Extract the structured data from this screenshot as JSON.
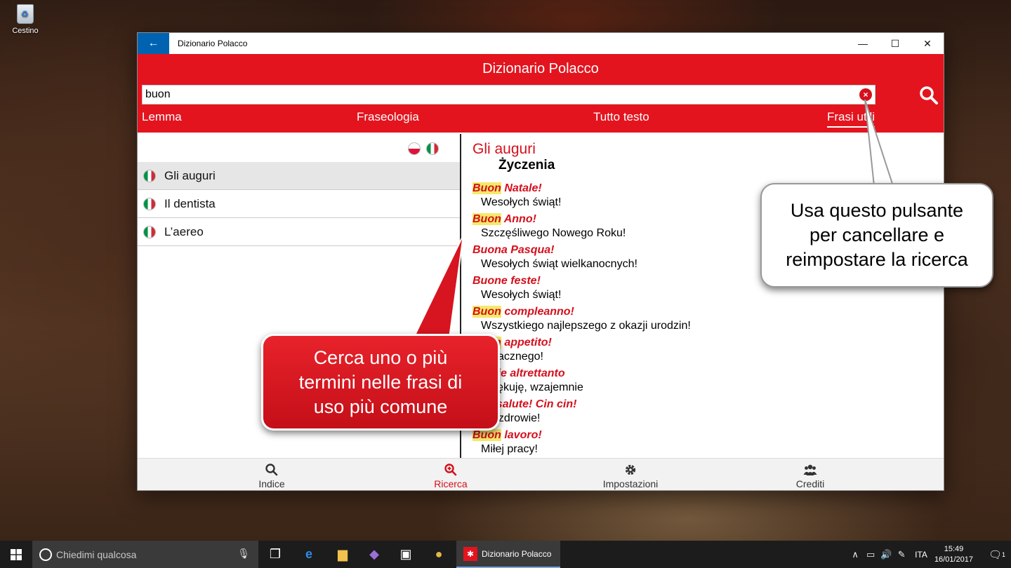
{
  "desktop": {
    "recycle_bin_label": "Cestino"
  },
  "window": {
    "titlebar_title": "Dizionario Polacco",
    "app_title": "Dizionario Polacco",
    "search": {
      "value": "buon",
      "placeholder": ""
    },
    "tabs": [
      {
        "label": "Lemma",
        "active": false
      },
      {
        "label": "Fraseologia",
        "active": false
      },
      {
        "label": "Tutto testo",
        "active": false
      },
      {
        "label": "Frasi utili",
        "active": true
      }
    ],
    "list_items": [
      {
        "label": "Gli auguri",
        "selected": true
      },
      {
        "label": "Il dentista",
        "selected": false
      },
      {
        "label": "L’aereo",
        "selected": false
      }
    ],
    "detail": {
      "title_it": "Gli auguri",
      "title_pl": "Życzenia",
      "phrases": [
        {
          "hl": "Buon",
          "it": " Natale!",
          "pl": "Wesołych świąt!"
        },
        {
          "hl": "Buon",
          "it": " Anno!",
          "pl": "Szczęśliwego Nowego Roku!"
        },
        {
          "hl": "",
          "it": "Buona Pasqua!",
          "pl": "Wesołych świąt wielkanocnych!"
        },
        {
          "hl": "",
          "it": "Buone feste!",
          "pl": "Wesołych świąt!"
        },
        {
          "hl": "Buon",
          "it": " compleanno!",
          "pl": "Wszystkiego najlepszego z okazji urodzin!"
        },
        {
          "hl": "Buon",
          "it": " appetito!",
          "pl": "Smacznego!"
        },
        {
          "hl": "",
          "it": "Grazie altrettanto",
          "pl": "Dziękuję, wzajemnie"
        },
        {
          "hl": "",
          "it": "Alla salute! Cin cin!",
          "pl": "Na zdrowie!"
        },
        {
          "hl": "Buon",
          "it": " lavoro!",
          "pl": "Miłej pracy!"
        }
      ]
    },
    "bottom_nav": [
      {
        "label": "Indice",
        "icon": "search-icon"
      },
      {
        "label": "Ricerca",
        "icon": "zoom-in-icon",
        "active": true
      },
      {
        "label": "Impostazioni",
        "icon": "gear-icon"
      },
      {
        "label": "Crediti",
        "icon": "people-icon"
      }
    ]
  },
  "callouts": {
    "red": {
      "lines": [
        "Cerca uno o più",
        "termini nelle frasi di",
        "uso più comune"
      ]
    },
    "white": {
      "lines": [
        "Usa questo pulsante",
        "per cancellare e",
        "reimpostare la ricerca"
      ]
    }
  },
  "taskbar": {
    "search_placeholder": "Chiedimi qualcosa",
    "active_app_label": "Dizionario Polacco",
    "language": "ITA",
    "time": "15:49",
    "date": "16/01/2017",
    "notification_count": "1"
  },
  "colors": {
    "brand_red": "#e3141e",
    "highlight": "#f5e96a",
    "titlebar_back": "#0063b1"
  }
}
